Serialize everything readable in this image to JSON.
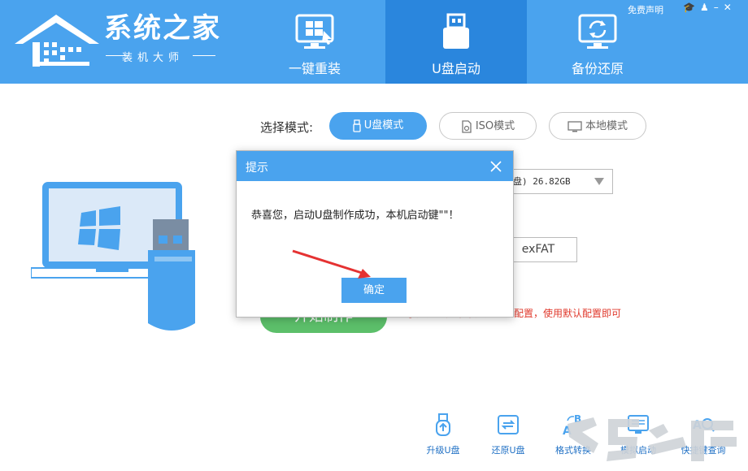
{
  "app": {
    "logo_title": "系统之家",
    "logo_subtitle": "装机大师",
    "top_links": "免费声明"
  },
  "tabs": [
    {
      "label": "一键重装",
      "icon": "windows-monitor-icon"
    },
    {
      "label": "U盘启动",
      "icon": "usb-drive-icon",
      "active": true
    },
    {
      "label": "备份还原",
      "icon": "restore-monitor-icon"
    }
  ],
  "modes": {
    "label": "选择模式:",
    "usb_mode": "U盘模式",
    "iso_mode": "ISO模式",
    "local_mode": "本地模式",
    "selected": "U盘模式"
  },
  "usb_device": {
    "value": "盘) 26.82GB"
  },
  "filesystem": {
    "value": "exFAT"
  },
  "start_button": {
    "label": "开始制作"
  },
  "hint": {
    "text": "小知道：如果不知道怎么配置，使用默认配置即可"
  },
  "tools": [
    {
      "label": "升级U盘",
      "icon": "usb-upgrade-icon"
    },
    {
      "label": "还原U盘",
      "icon": "usb-restore-icon"
    },
    {
      "label": "格式转换",
      "icon": "format-convert-icon"
    },
    {
      "label": "模拟启动",
      "icon": "simulate-boot-icon"
    },
    {
      "label": "快捷键查询",
      "icon": "hotkey-search-icon"
    }
  ],
  "dialog": {
    "title": "提示",
    "message": "恭喜您，启动U盘制作成功，本机启动键\"\"！",
    "ok_label": "确定"
  },
  "colors": {
    "header_blue": "#4aa3ee",
    "active_tab": "#2a86dd",
    "start_green": "#5cbf6a",
    "hint_red": "#e0392c"
  }
}
